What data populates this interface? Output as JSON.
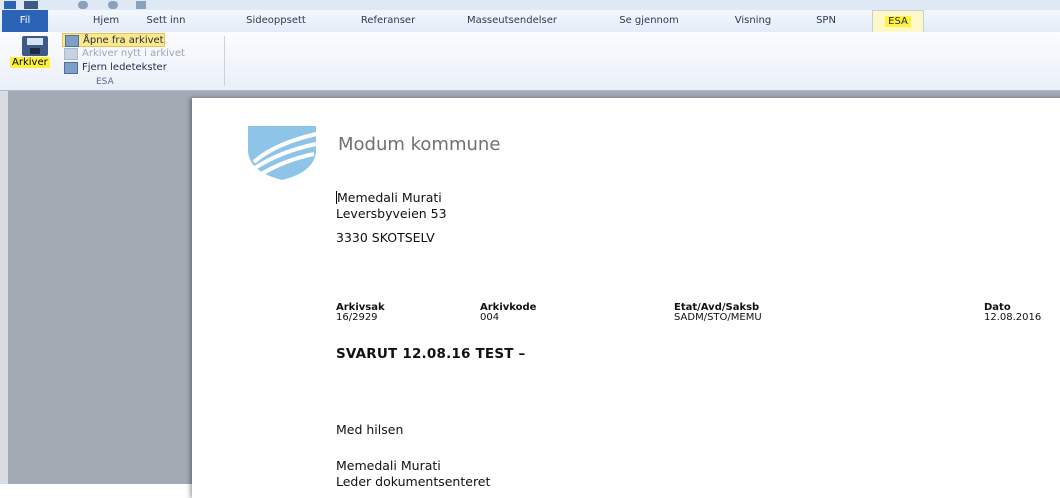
{
  "ribbon_tabs": {
    "file": "Fil",
    "home": "Hjem",
    "insert": "Sett inn",
    "page_layout": "Sideoppsett",
    "references": "Referanser",
    "mailings": "Masseutsendelser",
    "review": "Se gjennom",
    "view": "Visning",
    "spn": "SPN",
    "esa": "ESA"
  },
  "ribbon": {
    "archive_button": "Arkiver",
    "open_from_archive": "Åpne fra arkivet",
    "archive_new": "Arkiver nytt i arkivet",
    "remove_prompts": "Fjern ledetekster",
    "group_label": "ESA"
  },
  "document": {
    "municipality": "Modum kommune",
    "recipient_name": "Memedali Murati",
    "recipient_street": "Leversbyveien 53",
    "recipient_postal": "3330 SKOTSELV",
    "meta": {
      "arkivsak_label": "Arkivsak",
      "arkivsak_value": "16/2929",
      "arkivkode_label": "Arkivkode",
      "arkivkode_value": "004",
      "etat_label": "Etat/Avd/Saksb",
      "etat_value": "SADM/STO/MEMU",
      "dato_label": "Dato",
      "dato_value": "12.08.2016"
    },
    "subject": "SVARUT 12.08.16 TEST –",
    "greeting": "Med hilsen",
    "signer_name": "Memedali Murati",
    "signer_title": "Leder dokumentsenteret"
  },
  "colors": {
    "file_tab": "#2b63b7",
    "highlight": "#fff23a",
    "workspace": "#a4aab3",
    "logo": "#8ec4e8"
  }
}
